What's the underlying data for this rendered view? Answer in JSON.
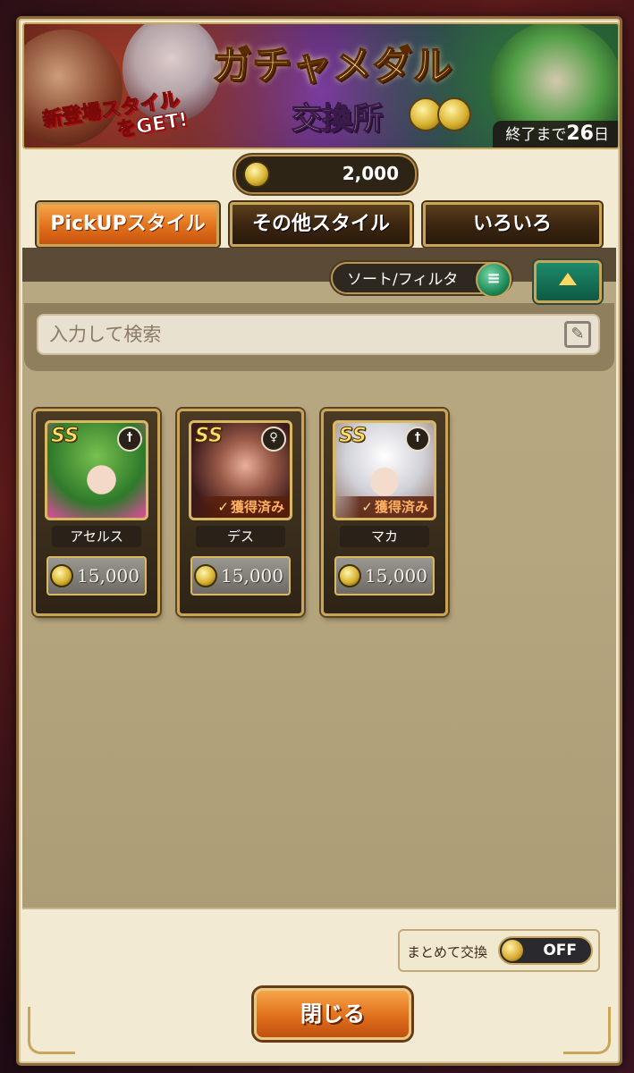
{
  "banner": {
    "title": "ガチャメダル",
    "subtitle": "交換所",
    "promo_line1": "新登場スタイル",
    "promo_line2": "をGET!",
    "period_prefix": "終了まで",
    "period_days": "26",
    "period_suffix": "日"
  },
  "currency": {
    "icon": "medal-coin-icon",
    "amount": "2,000"
  },
  "tabs": [
    {
      "label": "PickUPスタイル",
      "active": true
    },
    {
      "label": "その他スタイル",
      "active": false
    },
    {
      "label": "いろいろ",
      "active": false
    }
  ],
  "toolbar": {
    "sort_label": "ソート/フィルタ",
    "sort_icon": "list-icon",
    "collapse_icon": "triangle-up-icon"
  },
  "search": {
    "placeholder": "入力して検索"
  },
  "items": [
    {
      "grade": "SS",
      "weapon": "sword",
      "name": "アセルス",
      "owned": false,
      "cost": "15,000"
    },
    {
      "grade": "SS",
      "weapon": "staff",
      "name": "デス",
      "owned": true,
      "owned_label": "獲得済み",
      "cost": "15,000"
    },
    {
      "grade": "SS",
      "weapon": "sword",
      "name": "マカ",
      "owned": true,
      "owned_label": "獲得済み",
      "cost": "15,000"
    }
  ],
  "bulk_exchange": {
    "label": "まとめて交換",
    "state": "OFF"
  },
  "close_button": {
    "label": "閉じる"
  },
  "colors": {
    "accent_orange": "#e0701c",
    "frame_gold": "#c9a55a",
    "panel_tan": "#b8a882"
  }
}
